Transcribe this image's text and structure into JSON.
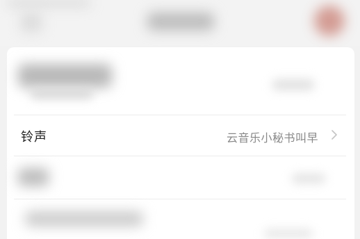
{
  "ringtone_row": {
    "label": "铃声",
    "value": "云音乐小秘书叫早",
    "chevron_icon": "chevron-right-icon"
  },
  "colors": {
    "label": "#222222",
    "value": "#888888",
    "chevron": "#c4c4c4",
    "background": "#f2f2f2",
    "card": "#ffffff"
  }
}
